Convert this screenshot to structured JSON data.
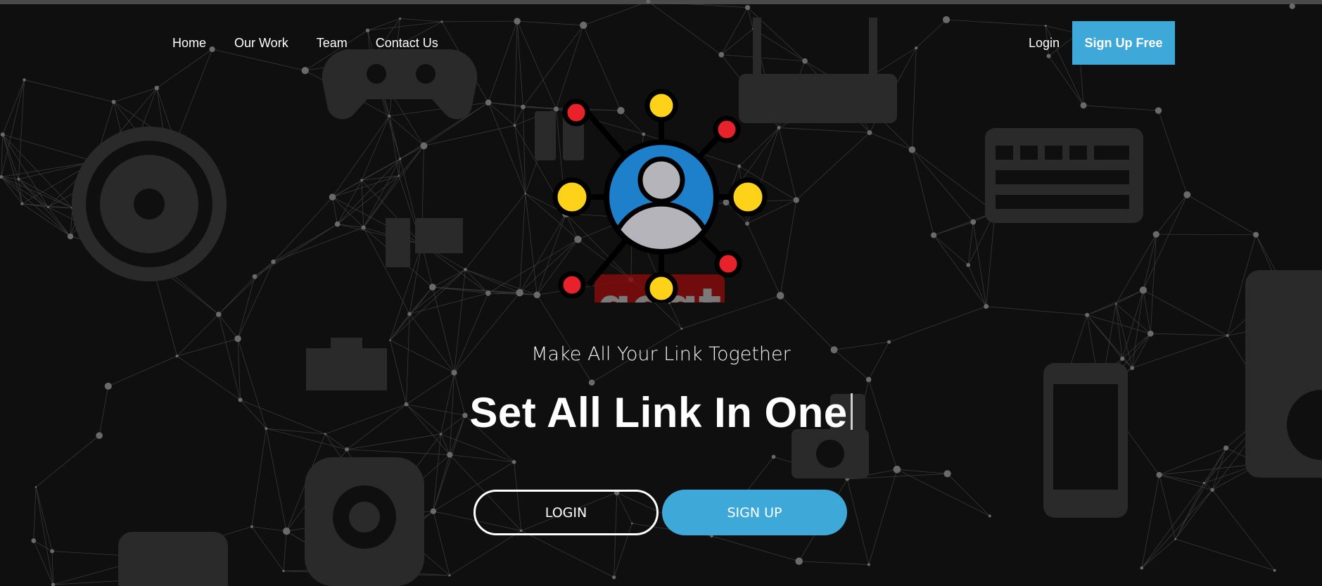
{
  "nav": {
    "items": [
      {
        "label": "Home"
      },
      {
        "label": "Our Work"
      },
      {
        "label": "Team"
      },
      {
        "label": "Contact Us"
      }
    ],
    "login_label": "Login",
    "signup_free_label": "Sign Up Free"
  },
  "hero": {
    "logo_text": "gogt",
    "subtitle": "Make All Your Link Together",
    "headline": "Set All Link In One",
    "login_button": "LOGIN",
    "signup_button": "SIGN UP"
  },
  "colors": {
    "accent": "#3ea9d8",
    "background": "#0f0f0f",
    "node_yellow": "#ffd21a",
    "node_red": "#e8222a",
    "avatar_blue": "#1e7fcb",
    "logo_red": "#8a0b0b"
  },
  "icons": {
    "background": [
      "gamepad-icon",
      "router-icon",
      "keyboard-icon",
      "disc-icon",
      "speakers-icon",
      "desktop-icon",
      "ethernet-icon",
      "smartphone-icon",
      "monitor-icon",
      "webcam-icon",
      "tablet-icon",
      "music-player-icon",
      "camera-icon"
    ],
    "hero": "user-network-icon"
  }
}
